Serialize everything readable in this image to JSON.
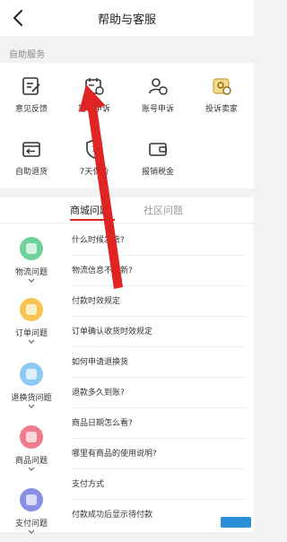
{
  "header": {
    "title": "帮助与客服"
  },
  "self_service": {
    "section_label": "自助服务",
    "items": [
      {
        "label": "意见反馈",
        "icon": "feedback-icon"
      },
      {
        "label": "笔记申诉",
        "icon": "notes-appeal-icon"
      },
      {
        "label": "账号申诉",
        "icon": "account-appeal-icon"
      },
      {
        "label": "投诉卖家",
        "icon": "complain-seller-icon"
      },
      {
        "label": "自助退货",
        "icon": "self-return-icon"
      },
      {
        "label": "7天保价",
        "icon": "price-protect-icon"
      },
      {
        "label": "报销税金",
        "icon": "tax-reimburse-icon"
      }
    ]
  },
  "tabs": [
    {
      "label": "商城问题",
      "active": true
    },
    {
      "label": "社区问题",
      "active": false
    }
  ],
  "categories": [
    {
      "label": "物流问题",
      "color": "#6dd39a"
    },
    {
      "label": "订单问题",
      "color": "#f6c453"
    },
    {
      "label": "退换货问题",
      "color": "#8ec9f2"
    },
    {
      "label": "商品问题",
      "color": "#f07b8c"
    },
    {
      "label": "支付问题",
      "color": "#8a8fe6"
    }
  ],
  "questions": [
    {
      "text": "什么时候发货?"
    },
    {
      "text": "物流信息不更新?"
    },
    {
      "text": "付款时效规定"
    },
    {
      "text": "订单确认收货时效规定"
    },
    {
      "text": "如何申请退换货"
    },
    {
      "text": "退款多久到账?"
    },
    {
      "text": "商品日期怎么看?"
    },
    {
      "text": "哪里有商品的使用说明?"
    },
    {
      "text": "支付方式"
    },
    {
      "text": "付款成功后显示待付款"
    }
  ],
  "colors": {
    "accent": "#e1251b",
    "annotation_arrow": "#e02424"
  }
}
